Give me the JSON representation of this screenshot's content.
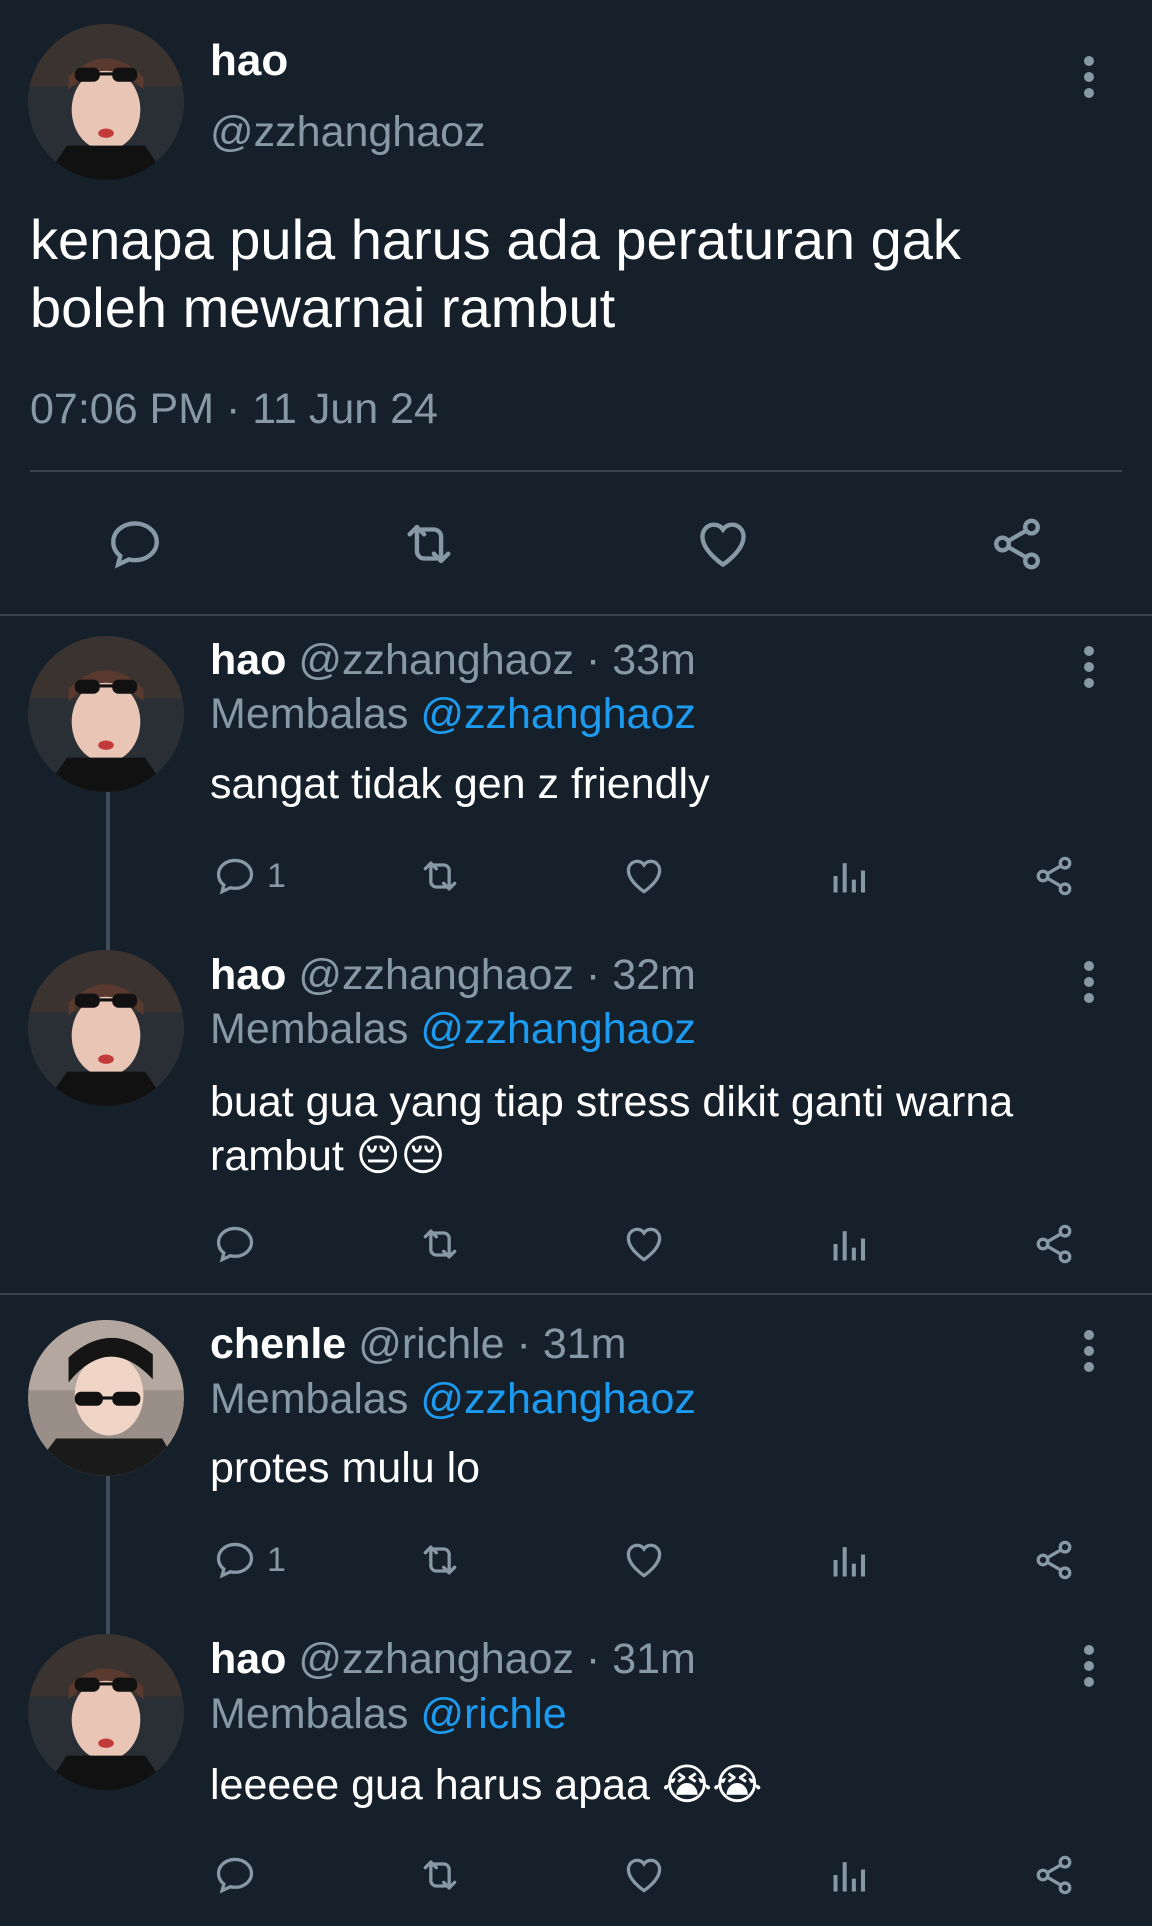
{
  "main_tweet": {
    "display_name": "hao",
    "handle": "@zzhanghaoz",
    "text_line1": "kenapa pula harus ada peraturan gak",
    "text_line2": "boleh mewarnai rambut",
    "timestamp": "07:06 PM · 11 Jun 24"
  },
  "replies": [
    {
      "display_name": "hao",
      "handle": "@zzhanghaoz",
      "time": "· 33m",
      "replying_label": "Membalas",
      "replying_to": "@zzhanghaoz",
      "text_line1": "sangat tidak gen z friendly",
      "reply_count": "1"
    },
    {
      "display_name": "hao",
      "handle": "@zzhanghaoz",
      "time": "· 32m",
      "replying_label": "Membalas",
      "replying_to": "@zzhanghaoz",
      "text_line1": "buat gua yang tiap stress dikit ganti warna",
      "text_line2": "rambut",
      "emoji": "😔😔",
      "reply_count": ""
    },
    {
      "display_name": "chenle",
      "handle": "@richle",
      "time": "· 31m",
      "replying_label": "Membalas",
      "replying_to": "@zzhanghaoz",
      "text_line1": "protes mulu lo",
      "reply_count": "1"
    },
    {
      "display_name": "hao",
      "handle": "@zzhanghaoz",
      "time": "· 31m",
      "replying_label": "Membalas",
      "replying_to": "@richle",
      "text_line1": "leeeee gua harus apaa",
      "emoji": "😭😭",
      "reply_count": ""
    }
  ],
  "colors": {
    "background": "#15202b",
    "text": "#ffffff",
    "muted": "#8899a6",
    "link": "#1d9bf0",
    "divider": "#38444d"
  }
}
